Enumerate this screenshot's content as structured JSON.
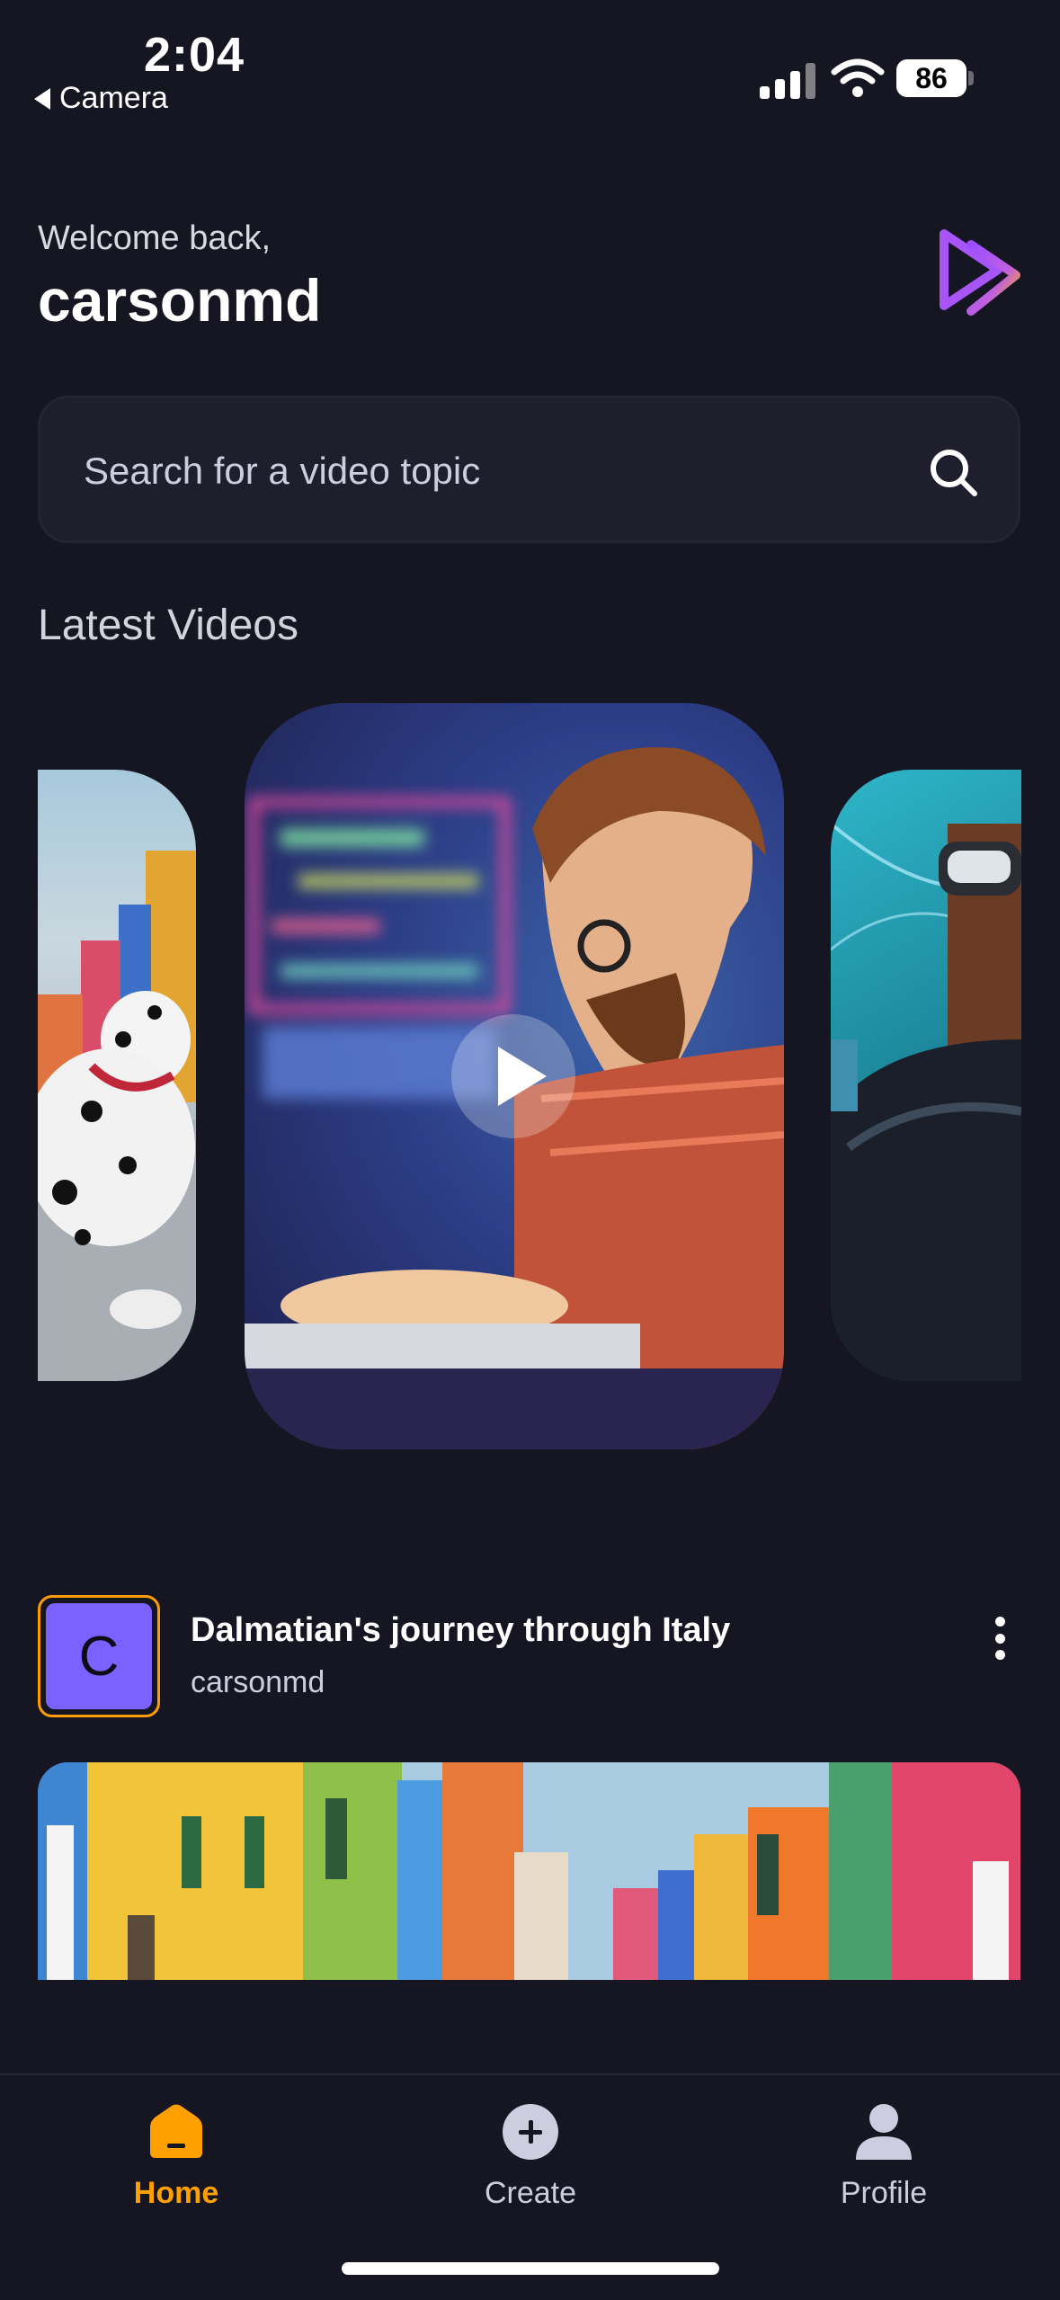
{
  "status_bar": {
    "time": "2:04",
    "back_label": "Camera",
    "battery": "86"
  },
  "header": {
    "greeting": "Welcome back,",
    "username": "carsonmd",
    "logo_icon": "play-logo-icon"
  },
  "search": {
    "placeholder": "Search for a video topic",
    "icon": "search-icon"
  },
  "latest": {
    "title": "Latest Videos",
    "cards": [
      {
        "position": "left",
        "scene": "dalmatian in italian street"
      },
      {
        "position": "center",
        "scene": "developer at laptop",
        "play_icon": "play-icon"
      },
      {
        "position": "right",
        "scene": "person wearing vr headset"
      }
    ]
  },
  "video_item": {
    "avatar_letter": "C",
    "title": "Dalmatian's journey through Italy",
    "creator": "carsonmd",
    "menu_icon": "more-vertical-icon"
  },
  "tabs": [
    {
      "label": "Home",
      "icon": "home-icon",
      "active": true
    },
    {
      "label": "Create",
      "icon": "plus-circle-icon",
      "active": false
    },
    {
      "label": "Profile",
      "icon": "profile-icon",
      "active": false
    }
  ],
  "colors": {
    "background": "#161622",
    "accent": "#FF9C01",
    "avatar_bg": "#7b61ff",
    "card_bg": "#1e1e2d"
  }
}
